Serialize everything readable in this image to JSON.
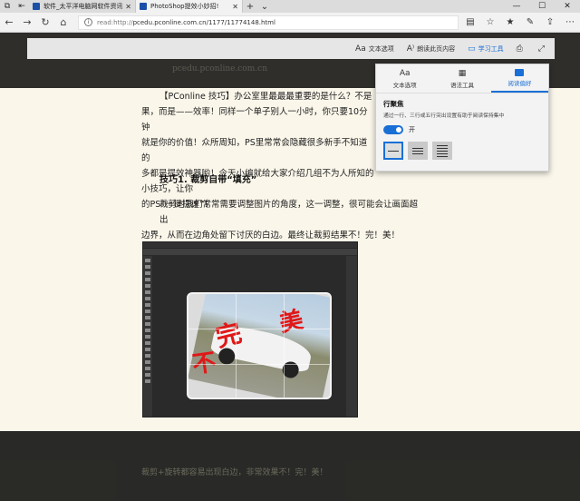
{
  "tabs": [
    {
      "label": "软件_太平洋电脑网软件资讯",
      "favicon_color": "#1a4fa8",
      "active": false
    },
    {
      "label": "PhotoShop提效小妙招!",
      "favicon_color": "#1a4fa8",
      "active": true
    }
  ],
  "address": {
    "prefix": "read:http://",
    "url": "pcedu.pconline.com.cn/1177/11774148.html"
  },
  "reader_toolbar": {
    "items": [
      {
        "icon": "Aa",
        "label": "文本选项"
      },
      {
        "icon": "A⁾",
        "label": "朗读此页内容"
      },
      {
        "icon": "▭",
        "label": "学习工具"
      }
    ]
  },
  "domain_text": "pcedu.pconline.com.cn",
  "article": {
    "intro_lines": [
      "【PConline 技巧】办公室里最最最重要的是什么？不是",
      "果，而是——效率！同样一个单子别人一小时，你只要10分钟",
      "就是你的价值！众所周知，PS里常常会隐藏很多新手不知道的",
      "多都是提效神器哟！今天小编就给大家介绍几组不为人所知的小技巧，让你",
      "的PS“一键提速”！"
    ],
    "heading": "技巧1. 裁剪自带“填充”",
    "para2_lines": [
      "裁剪时我们常常需要调整图片的角度，这一调整，很可能会让画面超出",
      "边界，从而在边角处留下讨厌的白边。最终让裁剪结果不！完！美！"
    ],
    "stamp_chars": [
      "不",
      "完",
      "美"
    ],
    "para3": "裁剪+旋转都容易出现白边，非常效果不！完！美！"
  },
  "flyout": {
    "tabs": [
      "文本选项",
      "语法工具",
      "阅读偏好"
    ],
    "heading": "行聚焦",
    "description": "通过一行、三行或五行突出设置有助于阅读保持集中",
    "toggle_label": "开",
    "toggle_on": true,
    "line_options": [
      "1",
      "3",
      "5"
    ],
    "selected_option": 0
  },
  "colors": {
    "accent": "#1a6fd6",
    "paper": "#faf6ea",
    "overlay": "#2b2b29",
    "stamp": "#e01818"
  }
}
